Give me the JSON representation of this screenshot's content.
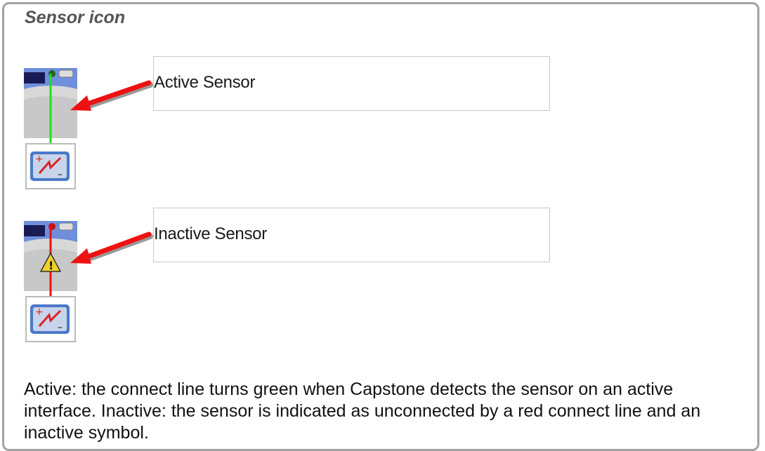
{
  "title": "Sensor icon",
  "callouts": [
    {
      "label": "Active Sensor",
      "state": "active",
      "line_color": "#22dd22",
      "pin_color": "#226622"
    },
    {
      "label": "Inactive Sensor",
      "state": "inactive",
      "line_color": "#ee1111",
      "pin_color": "#cc1111"
    }
  ],
  "description": "Active: the connect line turns green when Capstone detects the sensor on an active interface. Inactive: the sensor is indicated as unconnected by a red connect line and an inactive symbol.",
  "colors": {
    "arrow": "#ee1111",
    "frame": "#a3a3a3",
    "sensor_box": "#4a78c8",
    "warning": "#f3d02a"
  },
  "icons": [
    "interface-icon",
    "connection-port-icon",
    "voltage-sensor-icon",
    "warning-icon",
    "arrow-icon"
  ]
}
